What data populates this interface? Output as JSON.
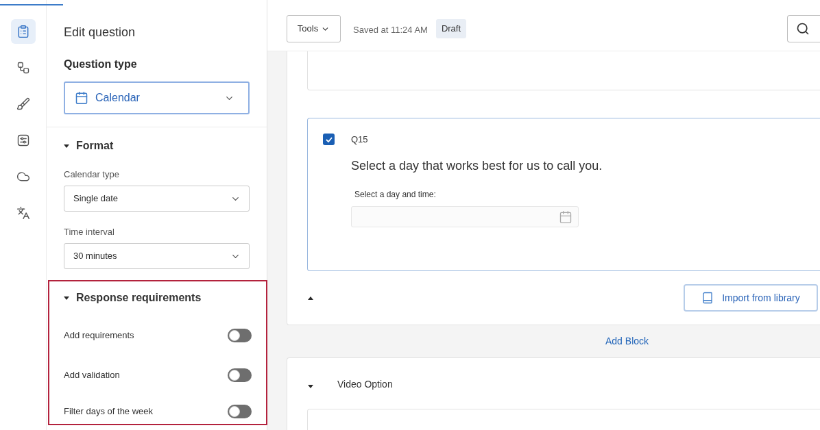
{
  "nav_rail": {
    "items": [
      {
        "selected": true
      },
      {
        "selected": false
      },
      {
        "selected": false
      },
      {
        "selected": false
      },
      {
        "selected": false
      },
      {
        "selected": false
      }
    ]
  },
  "editor_panel": {
    "title": "Edit question",
    "question_type": {
      "label": "Question type",
      "value": "Calendar"
    },
    "format": {
      "heading": "Format",
      "expanded": true,
      "fields": [
        {
          "label": "Calendar type",
          "value": "Single date"
        },
        {
          "label": "Time interval",
          "value": "30 minutes"
        }
      ]
    },
    "response_requirements": {
      "heading": "Response requirements",
      "expanded": true,
      "highlighted": true,
      "toggles": [
        {
          "label": "Add requirements",
          "on": false
        },
        {
          "label": "Add validation",
          "on": false
        },
        {
          "label": "Filter days of the week",
          "on": false
        }
      ]
    }
  },
  "toolbar": {
    "tools_button": "Tools",
    "save_status": "Saved at 11:24 AM",
    "status_badge": "Draft"
  },
  "survey": {
    "block": {
      "question": {
        "number": "Q15",
        "checked": true,
        "text": "Select a day that works best for us to call you.",
        "field_label": "Select a day and time:"
      },
      "import_button": "Import from library"
    },
    "add_block": "Add Block",
    "next_block": {
      "title": "Video Option"
    }
  }
}
